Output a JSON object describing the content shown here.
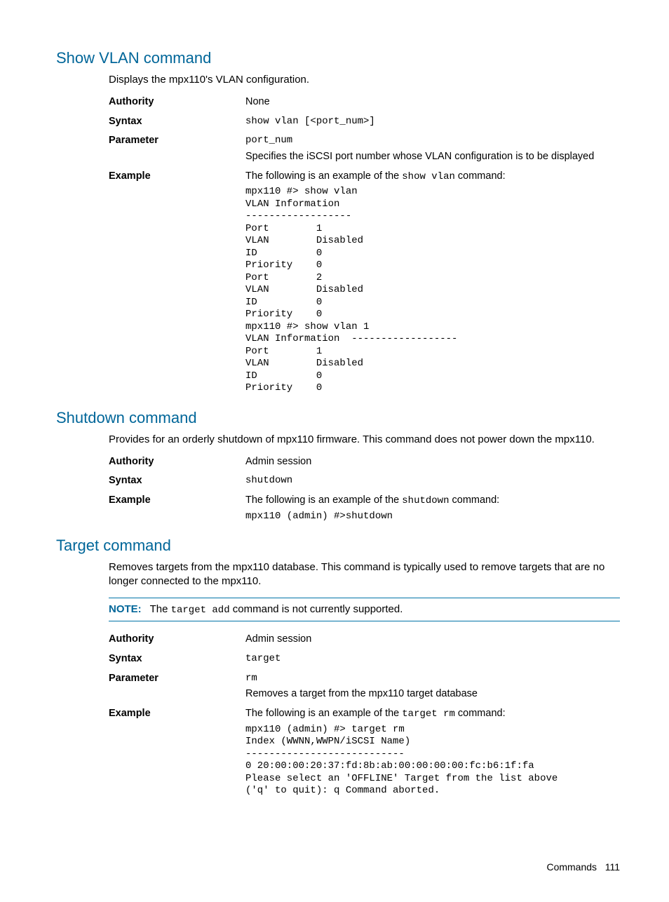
{
  "sections": {
    "showVlan": {
      "heading": "Show VLAN command",
      "intro": "Displays the mpx110's VLAN configuration.",
      "authorityLabel": "Authority",
      "authorityValue": "None",
      "syntaxLabel": "Syntax",
      "syntaxValue": "show vlan [<port_num>]",
      "parameterLabel": "Parameter",
      "parameterCode": "port_num",
      "parameterDesc": "Specifies the iSCSI port number whose VLAN configuration is to be displayed",
      "exampleLabel": "Example",
      "exampleIntroPrefix": "The following is an example of the ",
      "exampleIntroCode": "show vlan",
      "exampleIntroSuffix": " command:",
      "exampleBlock": "mpx110 #> show vlan\nVLAN Information\n------------------\nPort        1\nVLAN        Disabled\nID          0\nPriority    0\nPort        2\nVLAN        Disabled\nID          0\nPriority    0\nmpx110 #> show vlan 1\nVLAN Information  ------------------\nPort        1\nVLAN        Disabled\nID          0\nPriority    0"
    },
    "shutdown": {
      "heading": "Shutdown command",
      "intro": "Provides for an orderly shutdown of mpx110 firmware. This command does not power down the mpx110.",
      "authorityLabel": "Authority",
      "authorityValue": "Admin session",
      "syntaxLabel": "Syntax",
      "syntaxValue": "shutdown",
      "exampleLabel": "Example",
      "exampleIntroPrefix": "The following is an example of the ",
      "exampleIntroCode": "shutdown",
      "exampleIntroSuffix": " command:",
      "exampleBlock": "mpx110 (admin) #>shutdown"
    },
    "target": {
      "heading": "Target command",
      "intro": "Removes targets from the mpx110 database. This command is typically used to remove targets that are no longer connected to the mpx110.",
      "noteLabel": "NOTE:",
      "notePrefix": "The ",
      "noteCode": "target add",
      "noteSuffix": " command is not currently supported.",
      "authorityLabel": "Authority",
      "authorityValue": "Admin session",
      "syntaxLabel": "Syntax",
      "syntaxValue": "target",
      "parameterLabel": "Parameter",
      "parameterCode": "rm",
      "parameterDesc": "Removes a target from the mpx110 target database",
      "exampleLabel": "Example",
      "exampleIntroPrefix": "The following is an example of the ",
      "exampleIntroCode": "target rm",
      "exampleIntroSuffix": " command:",
      "exampleBlock": "mpx110 (admin) #> target rm\nIndex (WWNN,WWPN/iSCSI Name)\n---------------------------\n0 20:00:00:20:37:fd:8b:ab:00:00:00:00:fc:b6:1f:fa\nPlease select an 'OFFLINE' Target from the list above\n('q' to quit): q Command aborted."
    }
  },
  "footer": {
    "section": "Commands",
    "page": "111"
  }
}
